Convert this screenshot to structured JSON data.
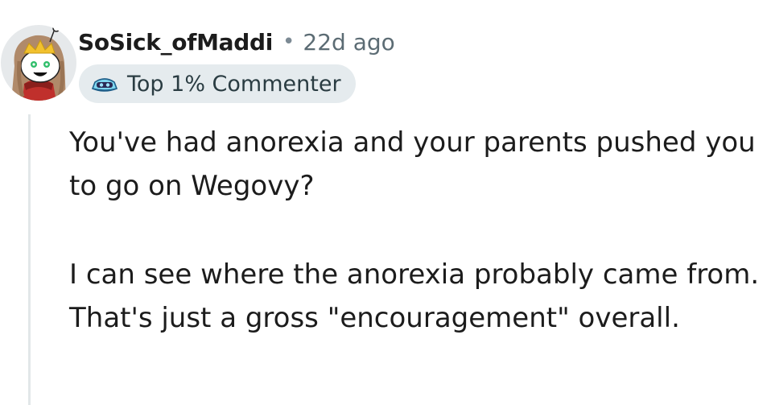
{
  "comment": {
    "author": {
      "username": "SoSick_ofMaddi",
      "avatar_icon": "snoo-avatar-icon"
    },
    "separator": "•",
    "timestamp": "22d ago",
    "flair": {
      "icon": "goggles-icon",
      "label": "Top 1% Commenter"
    },
    "paragraphs": [
      "You've had anorexia and your parents pushed you to go on Wegovy?",
      "I can see where the anorexia probably came from. That's just a gross \"encouragement\" overall."
    ]
  },
  "colors": {
    "username": "#1c1c1c",
    "meta": "#5c6c74",
    "flair_bg": "#e5ebee",
    "thread_line": "#e2e7e9",
    "text": "#1c1c1c"
  }
}
